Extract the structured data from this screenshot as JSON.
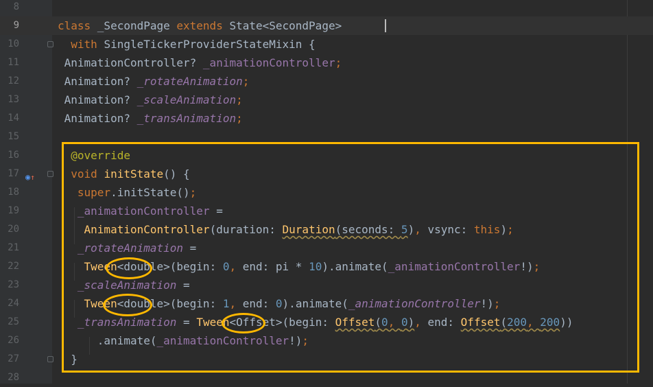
{
  "editor": {
    "lines": [
      {
        "num": "8",
        "tokens": []
      },
      {
        "num": "9",
        "tokens": [
          {
            "t": "class ",
            "c": "kw"
          },
          {
            "t": "_SecondPage "
          },
          {
            "t": "extends ",
            "c": "kw"
          },
          {
            "t": "State<SecondPage>"
          }
        ]
      },
      {
        "num": "10",
        "tokens": [
          {
            "t": "  "
          },
          {
            "t": "with ",
            "c": "kw"
          },
          {
            "t": "SingleTickerProviderStateMixin {"
          }
        ]
      },
      {
        "num": "11",
        "tokens": [
          {
            "t": " AnimationController? "
          },
          {
            "t": "_animationController",
            "c": "field"
          },
          {
            "t": ";",
            "c": "kw"
          }
        ]
      },
      {
        "num": "12",
        "tokens": [
          {
            "t": " Animation? "
          },
          {
            "t": "_rotateAnimation",
            "c": "field-i"
          },
          {
            "t": ";",
            "c": "kw"
          }
        ]
      },
      {
        "num": "13",
        "tokens": [
          {
            "t": " Animation? "
          },
          {
            "t": "_scaleAnimation",
            "c": "field-i"
          },
          {
            "t": ";",
            "c": "kw"
          }
        ]
      },
      {
        "num": "14",
        "tokens": [
          {
            "t": " Animation? "
          },
          {
            "t": "_transAnimation",
            "c": "field-i"
          },
          {
            "t": ";",
            "c": "kw"
          }
        ]
      },
      {
        "num": "15",
        "tokens": []
      },
      {
        "num": "16",
        "tokens": [
          {
            "t": "  "
          },
          {
            "t": "@override",
            "c": "ann"
          }
        ]
      },
      {
        "num": "17",
        "tokens": [
          {
            "t": "  "
          },
          {
            "t": "void ",
            "c": "kw"
          },
          {
            "t": "initState",
            "c": "fn"
          },
          {
            "t": "() {"
          }
        ]
      },
      {
        "num": "18",
        "tokens": [
          {
            "t": "   "
          },
          {
            "t": "super",
            "c": "kw"
          },
          {
            "t": ".initState()"
          },
          {
            "t": ";",
            "c": "kw"
          }
        ]
      },
      {
        "num": "19",
        "tokens": [
          {
            "t": "   "
          },
          {
            "t": "_animationController",
            "c": "field"
          },
          {
            "t": " ="
          }
        ]
      },
      {
        "num": "20",
        "tokens": [
          {
            "t": "    "
          },
          {
            "t": "AnimationController",
            "c": "fn"
          },
          {
            "t": "(duration: "
          },
          {
            "t": "Duration",
            "c": "fn warn"
          },
          {
            "t": "(seconds: ",
            "c": "warn"
          },
          {
            "t": "5",
            "c": "num warn"
          },
          {
            "t": ")"
          },
          {
            "t": ", ",
            "c": "kw"
          },
          {
            "t": "vsync: "
          },
          {
            "t": "this",
            "c": "kw"
          },
          {
            "t": ")"
          },
          {
            "t": ";",
            "c": "kw"
          }
        ]
      },
      {
        "num": "21",
        "tokens": [
          {
            "t": "   "
          },
          {
            "t": "_rotateAnimation",
            "c": "field-i"
          },
          {
            "t": " ="
          }
        ]
      },
      {
        "num": "22",
        "tokens": [
          {
            "t": "    "
          },
          {
            "t": "Tween",
            "c": "fn"
          },
          {
            "t": "<double>(begin: "
          },
          {
            "t": "0",
            "c": "num"
          },
          {
            "t": ", ",
            "c": "kw"
          },
          {
            "t": "end: pi * "
          },
          {
            "t": "10",
            "c": "num"
          },
          {
            "t": ").animate("
          },
          {
            "t": "_animationController",
            "c": "field"
          },
          {
            "t": "!)"
          },
          {
            "t": ";",
            "c": "kw"
          }
        ]
      },
      {
        "num": "23",
        "tokens": [
          {
            "t": "   "
          },
          {
            "t": "_scaleAnimation",
            "c": "field-i"
          },
          {
            "t": " ="
          }
        ]
      },
      {
        "num": "24",
        "tokens": [
          {
            "t": "    "
          },
          {
            "t": "Tween",
            "c": "fn"
          },
          {
            "t": "<double>(begin: "
          },
          {
            "t": "1",
            "c": "num"
          },
          {
            "t": ", ",
            "c": "kw"
          },
          {
            "t": "end: "
          },
          {
            "t": "0",
            "c": "num"
          },
          {
            "t": ").animate("
          },
          {
            "t": "_animationController",
            "c": "field-i"
          },
          {
            "t": "!)"
          },
          {
            "t": ";",
            "c": "kw"
          }
        ]
      },
      {
        "num": "25",
        "tokens": [
          {
            "t": "   "
          },
          {
            "t": "_transAnimation",
            "c": "field-i"
          },
          {
            "t": " = "
          },
          {
            "t": "Tween",
            "c": "fn"
          },
          {
            "t": "<Offset>(begin: "
          },
          {
            "t": "Offset",
            "c": "fn warn"
          },
          {
            "t": "(",
            "c": "warn"
          },
          {
            "t": "0",
            "c": "num warn"
          },
          {
            "t": ", ",
            "c": "kw warn"
          },
          {
            "t": "0",
            "c": "num warn"
          },
          {
            "t": ")",
            "c": "warn"
          },
          {
            "t": ", ",
            "c": "kw"
          },
          {
            "t": "end: "
          },
          {
            "t": "Offset",
            "c": "fn warn"
          },
          {
            "t": "(",
            "c": "warn"
          },
          {
            "t": "200",
            "c": "num warn"
          },
          {
            "t": ", ",
            "c": "kw warn"
          },
          {
            "t": "200",
            "c": "num warn"
          },
          {
            "t": "))"
          }
        ]
      },
      {
        "num": "26",
        "tokens": [
          {
            "t": "      .animate("
          },
          {
            "t": "_animationController",
            "c": "field"
          },
          {
            "t": "!)"
          },
          {
            "t": ";",
            "c": "kw"
          }
        ]
      },
      {
        "num": "27",
        "tokens": [
          {
            "t": "  }"
          }
        ]
      },
      {
        "num": "28",
        "tokens": []
      }
    ],
    "current_line": "9",
    "fold_lines": [
      "10",
      "17",
      "27"
    ],
    "override_line": "17",
    "icons": {
      "override": "override-gutter-icon",
      "fold": "fold-marker-icon"
    }
  },
  "colors": {
    "background": "#2b2b2b",
    "gutter": "#313335",
    "highlight": "#ffb800",
    "keyword": "#cc7832",
    "field": "#9876aa",
    "number": "#6897bb",
    "function": "#ffc66d",
    "annotation": "#bbb529"
  },
  "annotations": {
    "highlighted_block": "override-initstate-block",
    "circled_token": "Tween"
  }
}
